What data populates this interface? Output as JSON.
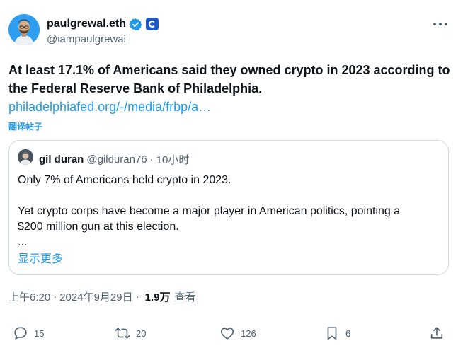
{
  "author": {
    "display_name": "paulgrewal.eth",
    "handle": "@iampaulgrewal"
  },
  "tweet": {
    "text": "At least 17.1% of Americans said they owned crypto in 2023 according to the Federal Reserve Bank of Philadelphia.",
    "link": "philadelphiafed.org/-/media/frbp/a…",
    "translate_label": "翻译帖子"
  },
  "quote": {
    "display_name": "gil duran",
    "handle": "@gilduran76",
    "separator": "·",
    "time": "10小时",
    "lines": [
      "Only 7% of Americans held crypto in 2023.",
      "",
      "Yet crypto corps have become a major player in American politics, pointing a",
      "$200 million gun at this election.",
      "..."
    ],
    "show_more": "显示更多"
  },
  "meta": {
    "time": "上午6:20",
    "separator": "·",
    "date": "2024年9月29日",
    "separator2": "·",
    "views": "1.9万",
    "views_label": "查看"
  },
  "actions": {
    "reply_count": "15",
    "retweet_count": "20",
    "like_count": "126",
    "bookmark_count": "6"
  },
  "colors": {
    "link": "#1d9bf0",
    "secondary_text": "#536471",
    "border": "#cfd9de",
    "verified": "#1d9bf0",
    "affiliate_badge": "#1d57c8"
  }
}
